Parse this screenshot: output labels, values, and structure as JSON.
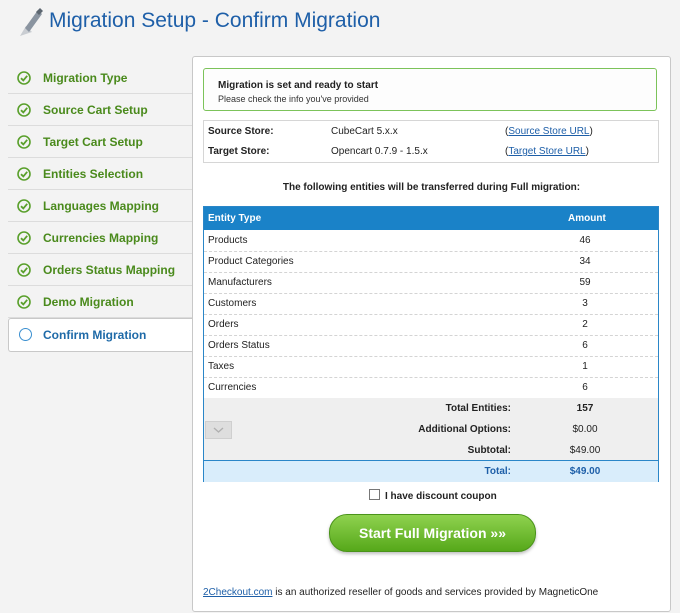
{
  "header": {
    "title": "Migration Setup - Confirm Migration"
  },
  "sidebar": {
    "items": [
      {
        "label": "Migration Type",
        "state": "done"
      },
      {
        "label": "Source Cart Setup",
        "state": "done"
      },
      {
        "label": "Target Cart Setup",
        "state": "done"
      },
      {
        "label": "Entities Selection",
        "state": "done"
      },
      {
        "label": "Languages Mapping",
        "state": "done"
      },
      {
        "label": "Currencies Mapping",
        "state": "done"
      },
      {
        "label": "Orders Status Mapping",
        "state": "done"
      },
      {
        "label": "Demo Migration",
        "state": "done"
      },
      {
        "label": "Confirm Migration",
        "state": "active"
      }
    ]
  },
  "status": {
    "title": "Migration is set and ready to start",
    "subtitle": "Please check the info you've provided"
  },
  "stores": {
    "source_label": "Source Store:",
    "source_value": "CubeCart 5.x.x",
    "source_link": "Source Store URL",
    "target_label": "Target Store:",
    "target_value": "Opencart 0.7.9 - 1.5.x",
    "target_link": "Target Store URL"
  },
  "entities_heading": "The following entities will be transferred during Full migration:",
  "table": {
    "headers": {
      "entity": "Entity Type",
      "amount": "Amount"
    },
    "rows": [
      {
        "entity": "Products",
        "amount": "46"
      },
      {
        "entity": "Product Categories",
        "amount": "34"
      },
      {
        "entity": "Manufacturers",
        "amount": "59"
      },
      {
        "entity": "Customers",
        "amount": "3"
      },
      {
        "entity": "Orders",
        "amount": "2"
      },
      {
        "entity": "Orders Status",
        "amount": "6"
      },
      {
        "entity": "Taxes",
        "amount": "1"
      },
      {
        "entity": "Currencies",
        "amount": "6"
      }
    ],
    "total_entities_label": "Total Entities:",
    "total_entities_value": "157",
    "additional_options_label": "Additional Options:",
    "additional_options_value": "$0.00",
    "subtotal_label": "Subtotal:",
    "subtotal_value": "$49.00",
    "total_label": "Total:",
    "total_value": "$49.00"
  },
  "coupon_label": "I have discount coupon",
  "start_button": "Start Full Migration »»",
  "footer": {
    "link": "2Checkout.com",
    "text": " is an authorized reseller of goods and services provided by MagneticOne"
  },
  "colors": {
    "title_blue": "#1e5fa8",
    "sidebar_green": "#4a8a1c",
    "table_header": "#1a82c8",
    "button_green": "#6cbf2e"
  }
}
